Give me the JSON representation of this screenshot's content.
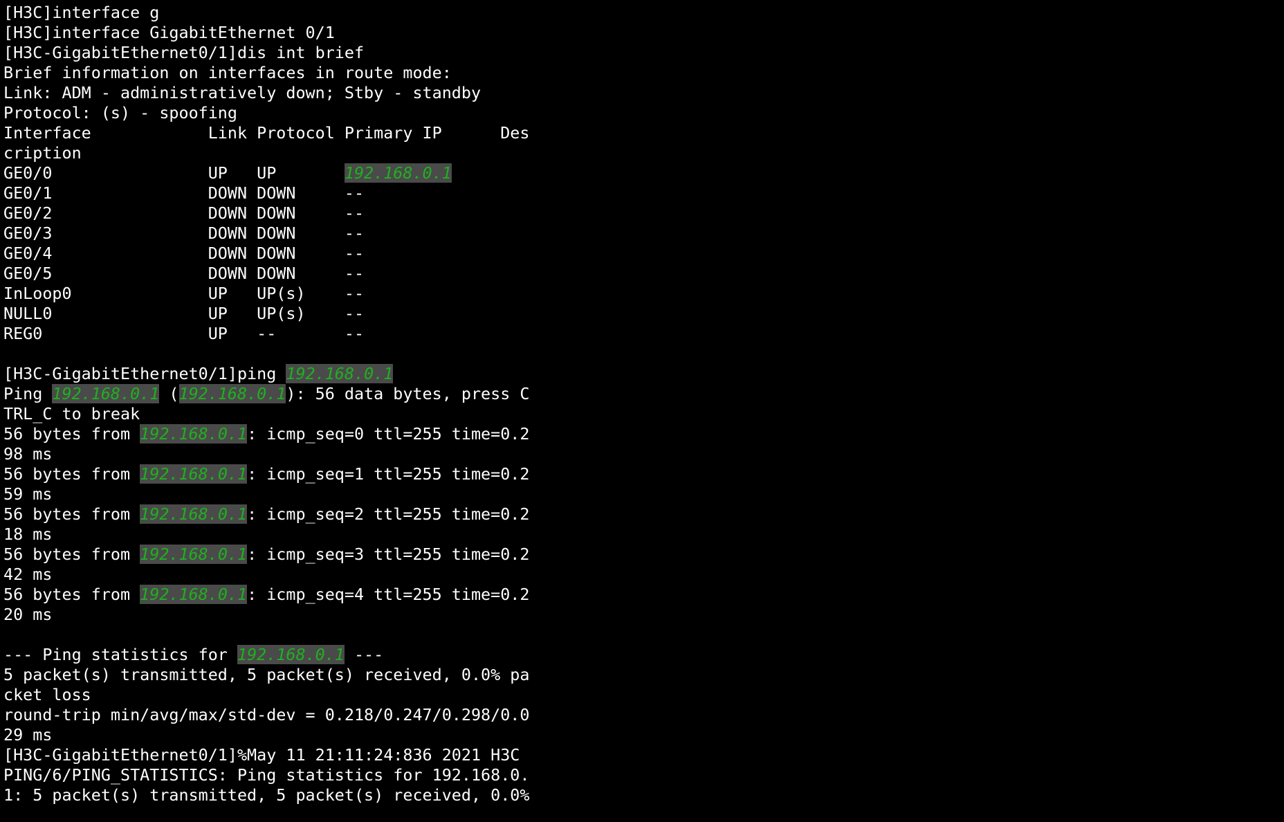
{
  "colors": {
    "background": "#000000",
    "text": "#ffffff",
    "highlight_text": "#1fb01f",
    "highlight_background": "#4a4a4a"
  },
  "terminal": {
    "lines": [
      [
        {
          "text": "[H3C]interface g"
        }
      ],
      [
        {
          "text": "[H3C]interface GigabitEthernet 0/1"
        }
      ],
      [
        {
          "text": "[H3C-GigabitEthernet0/1]dis int brief"
        }
      ],
      [
        {
          "text": "Brief information on interfaces in route mode:"
        }
      ],
      [
        {
          "text": "Link: ADM - administratively down; Stby - standby"
        }
      ],
      [
        {
          "text": "Protocol: (s) - spoofing"
        }
      ],
      [
        {
          "text": "Interface            Link Protocol Primary IP      Des"
        }
      ],
      [
        {
          "text": "cription"
        }
      ],
      [
        {
          "text": "GE0/0                UP   UP       "
        },
        {
          "text": "192.168.0.1",
          "hl": true
        }
      ],
      [
        {
          "text": "GE0/1                DOWN DOWN     --"
        }
      ],
      [
        {
          "text": "GE0/2                DOWN DOWN     --"
        }
      ],
      [
        {
          "text": "GE0/3                DOWN DOWN     --"
        }
      ],
      [
        {
          "text": "GE0/4                DOWN DOWN     --"
        }
      ],
      [
        {
          "text": "GE0/5                DOWN DOWN     --"
        }
      ],
      [
        {
          "text": "InLoop0              UP   UP(s)    --"
        }
      ],
      [
        {
          "text": "NULL0                UP   UP(s)    --"
        }
      ],
      [
        {
          "text": "REG0                 UP   --       --"
        }
      ],
      [
        {
          "text": ""
        }
      ],
      [
        {
          "text": "[H3C-GigabitEthernet0/1]ping "
        },
        {
          "text": "192.168.0.1",
          "hl": true
        }
      ],
      [
        {
          "text": "Ping "
        },
        {
          "text": "192.168.0.1",
          "hl": true
        },
        {
          "text": " ("
        },
        {
          "text": "192.168.0.1",
          "hl": true
        },
        {
          "text": "): 56 data bytes, press C"
        }
      ],
      [
        {
          "text": "TRL_C to break"
        }
      ],
      [
        {
          "text": "56 bytes from "
        },
        {
          "text": "192.168.0.1",
          "hl": true
        },
        {
          "text": ": icmp_seq=0 ttl=255 time=0.2"
        }
      ],
      [
        {
          "text": "98 ms"
        }
      ],
      [
        {
          "text": "56 bytes from "
        },
        {
          "text": "192.168.0.1",
          "hl": true
        },
        {
          "text": ": icmp_seq=1 ttl=255 time=0.2"
        }
      ],
      [
        {
          "text": "59 ms"
        }
      ],
      [
        {
          "text": "56 bytes from "
        },
        {
          "text": "192.168.0.1",
          "hl": true
        },
        {
          "text": ": icmp_seq=2 ttl=255 time=0.2"
        }
      ],
      [
        {
          "text": "18 ms"
        }
      ],
      [
        {
          "text": "56 bytes from "
        },
        {
          "text": "192.168.0.1",
          "hl": true
        },
        {
          "text": ": icmp_seq=3 ttl=255 time=0.2"
        }
      ],
      [
        {
          "text": "42 ms"
        }
      ],
      [
        {
          "text": "56 bytes from "
        },
        {
          "text": "192.168.0.1",
          "hl": true
        },
        {
          "text": ": icmp_seq=4 ttl=255 time=0.2"
        }
      ],
      [
        {
          "text": "20 ms"
        }
      ],
      [
        {
          "text": ""
        }
      ],
      [
        {
          "text": "--- Ping statistics for "
        },
        {
          "text": "192.168.0.1",
          "hl": true
        },
        {
          "text": " ---"
        }
      ],
      [
        {
          "text": "5 packet(s) transmitted, 5 packet(s) received, 0.0% pa"
        }
      ],
      [
        {
          "text": "cket loss"
        }
      ],
      [
        {
          "text": "round-trip min/avg/max/std-dev = 0.218/0.247/0.298/0.0"
        }
      ],
      [
        {
          "text": "29 ms"
        }
      ],
      [
        {
          "text": "[H3C-GigabitEthernet0/1]%May 11 21:11:24:836 2021 H3C"
        }
      ],
      [
        {
          "text": "PING/6/PING_STATISTICS: Ping statistics for 192.168.0."
        }
      ],
      [
        {
          "text": "1: 5 packet(s) transmitted, 5 packet(s) received, 0.0%"
        }
      ]
    ]
  }
}
